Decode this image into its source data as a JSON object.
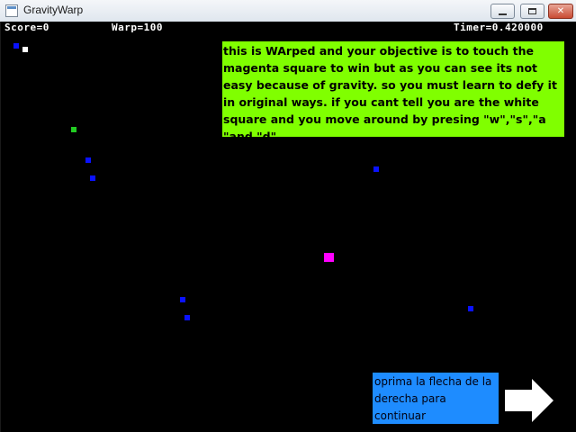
{
  "window": {
    "title": "GravityWarp",
    "icon": "app-window-icon",
    "controls": [
      "minimize-icon",
      "maximize-icon",
      "close-icon"
    ]
  },
  "hud": {
    "score": "Score=0",
    "warp": "Warp=100",
    "timer": "Timer=0.420000"
  },
  "instructions": "this is WArped and your objective is to touch the magenta square to win but as you can see its not easy because of gravity. so you must learn to defy it in original ways. if you cant tell you are the white square and you move around by presing \"w\",\"s\",\"a \"and \"d\".",
  "hint": "oprima la flecha de la derecha para continuar",
  "next_icon": "right-arrow-icon",
  "colors": {
    "background": "#000000",
    "player": "#ffffff",
    "goal": "#ff00ff",
    "obstacle": "#0a12ff",
    "warp_pickup": "#22cc22",
    "instruction_box": "#80ff00",
    "hint_box": "#1e8cff",
    "hud_text": "#ffffff"
  }
}
